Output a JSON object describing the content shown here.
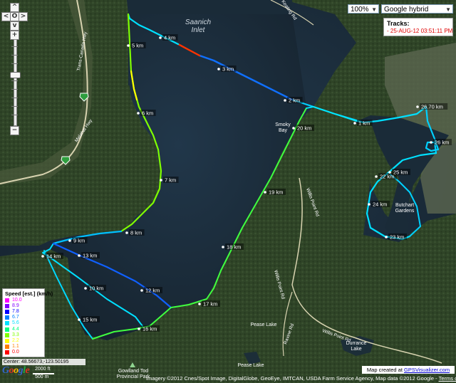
{
  "map_controls": {
    "pan_up": "^",
    "pan_left": "<",
    "pan_center": "O",
    "pan_right": ">",
    "pan_down": "v",
    "zoom_in": "+",
    "zoom_out": "−"
  },
  "top_controls": {
    "zoom_percent": "100%",
    "map_type": "Google hybrid"
  },
  "tracks_box": {
    "title": "Tracks:",
    "item": "- 25-AUG-12 03:51:11 PM"
  },
  "water_labels": [
    "Saanich",
    "Inlet"
  ],
  "place_labels": {
    "smokey_bay": [
      "Smoky",
      "Bay"
    ],
    "gardens": [
      "Butchart",
      "Gardens"
    ],
    "pease_lake": "Pease Lake",
    "durrance_lake": [
      "Durrance",
      "Lake"
    ],
    "gowlland_park": [
      "Gowlland Tod",
      "Provincial Park"
    ],
    "pease_lake_2": "Pease Lake"
  },
  "road_labels": {
    "trans_canada": "Trans-Canada Hwy",
    "malahat": "Malahat Hwy",
    "willis_point_1": "Willis Point Rd",
    "willis_point_2": "Willis Point Rd",
    "willis_point_3": "Willis Point Rd",
    "ravine": "Ravine Rd",
    "top_road": "Keating Rd"
  },
  "km_labels": [
    "1 km",
    "2 km",
    "3 km",
    "4 km",
    "5 km",
    "6 km",
    "7 km",
    "8 km",
    "9 km",
    "10 km",
    "12 km",
    "13 km",
    "14 km",
    "15 km",
    "16 km",
    "17 km",
    "18 km",
    "19 km",
    "20 km",
    "22 km",
    "23 km",
    "24 km",
    "25 km",
    "26 km",
    "26.70 km"
  ],
  "legend": {
    "title": "Speed [est.] (km/h)",
    "entries": [
      {
        "value": "10.0",
        "color": "#ff00ff"
      },
      {
        "value": "8.9",
        "color": "#8000ff"
      },
      {
        "value": "7.8",
        "color": "#0000ff"
      },
      {
        "value": "6.7",
        "color": "#0080ff"
      },
      {
        "value": "5.6",
        "color": "#00e0ff"
      },
      {
        "value": "4.4",
        "color": "#00ff80"
      },
      {
        "value": "3.3",
        "color": "#80ff00"
      },
      {
        "value": "2.2",
        "color": "#ffff00"
      },
      {
        "value": "1.1",
        "color": "#ff8000"
      },
      {
        "value": "0.0",
        "color": "#ff0000"
      }
    ]
  },
  "center_readout": "Center: 48.56673,-123.50195",
  "google_logo": "Google",
  "scale": {
    "top": "2000 ft",
    "bottom": "500 m"
  },
  "attribution": {
    "text": "Imagery ©2012 Cnes/Spot Image, DigitalGlobe, GeoEye, IMTCAN, USDA Farm Service Agency, Map data ©2012 Google - ",
    "link": "Terms of Use"
  },
  "credit": {
    "prefix": "Map created at ",
    "link": "GPSVisualizer.com"
  },
  "colors": {
    "water": "#1b2a36",
    "forest": "#2e4226",
    "track_main": "#00d0ff",
    "track_fast": "#0050ff"
  }
}
